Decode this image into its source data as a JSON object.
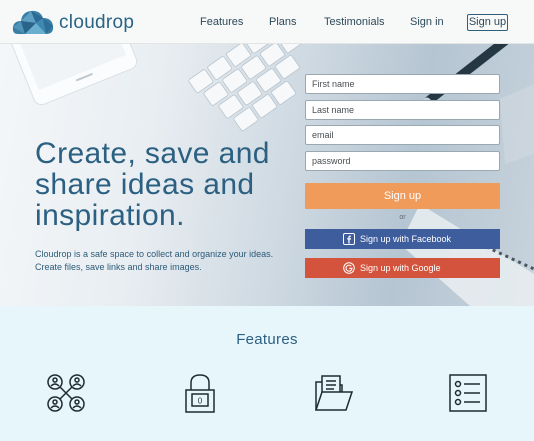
{
  "header": {
    "brand": "cloudrop",
    "nav": [
      {
        "label": "Features"
      },
      {
        "label": "Plans"
      },
      {
        "label": "Testimonials"
      },
      {
        "label": "Sign in"
      }
    ],
    "signup_label": "Sign up"
  },
  "hero": {
    "headline": "Create, save and share ideas and inspiration.",
    "subtext": "Cloudrop is a safe space to collect and organize your ideas. Create files, save links and share images."
  },
  "form": {
    "first_name_placeholder": "First name",
    "last_name_placeholder": "Last name",
    "email_placeholder": "email",
    "password_placeholder": "password",
    "signup_button": "Sign up",
    "or_text": "or",
    "facebook_button": "Sign up with Facebook",
    "google_button": "Sign up with Google"
  },
  "features": {
    "title": "Features",
    "icons": [
      "network-people-icon",
      "lock-icon",
      "folder-icon",
      "list-icon"
    ]
  },
  "colors": {
    "brand": "#2c6082",
    "signup": "#f19b5b",
    "facebook": "#3d5d9d",
    "google": "#d4533c",
    "features_bg": "#e6f6fb"
  }
}
